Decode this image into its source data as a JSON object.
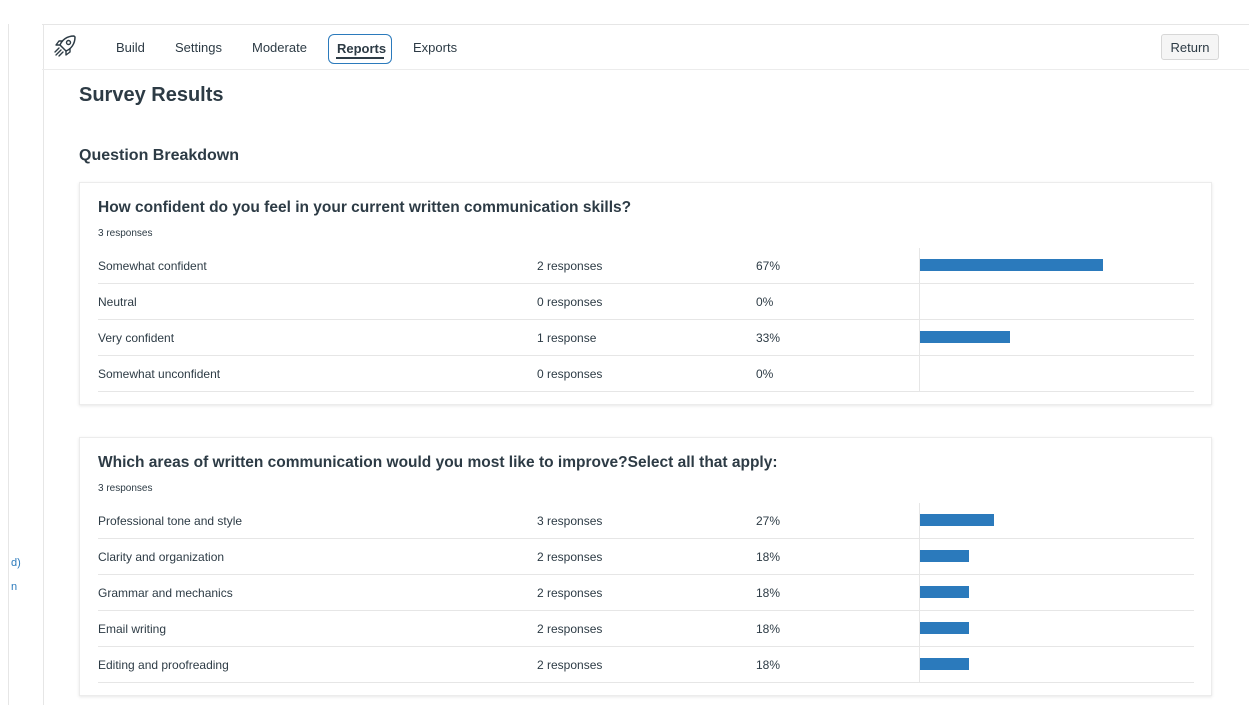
{
  "left_strip": {
    "fragments": [
      "d)",
      "n"
    ]
  },
  "nav": {
    "logo_icon": "rocket-icon",
    "tabs": [
      {
        "label": "Build",
        "active": false
      },
      {
        "label": "Settings",
        "active": false
      },
      {
        "label": "Moderate",
        "active": false
      },
      {
        "label": "Reports",
        "active": true
      },
      {
        "label": "Exports",
        "active": false
      }
    ],
    "return_label": "Return"
  },
  "page": {
    "title": "Survey Results",
    "section_title": "Question Breakdown"
  },
  "colors": {
    "accent": "#2b7abc",
    "text": "#2d3b45"
  },
  "questions": [
    {
      "title": "How confident do you feel in your current written communication skills?",
      "responses": "3 responses",
      "options": [
        {
          "label": "Somewhat confident",
          "count": "2 responses",
          "percent": "67%",
          "fraction": 0.67
        },
        {
          "label": "Neutral",
          "count": "0 responses",
          "percent": "0%",
          "fraction": 0
        },
        {
          "label": "Very confident",
          "count": "1 response",
          "percent": "33%",
          "fraction": 0.33
        },
        {
          "label": "Somewhat unconfident",
          "count": "0 responses",
          "percent": "0%",
          "fraction": 0
        }
      ]
    },
    {
      "title": "Which areas of written communication would you most like to improve?Select all that apply:",
      "responses": "3 responses",
      "options": [
        {
          "label": "Professional tone and style",
          "count": "3 responses",
          "percent": "27%",
          "fraction": 0.27
        },
        {
          "label": "Clarity and organization",
          "count": "2 responses",
          "percent": "18%",
          "fraction": 0.18
        },
        {
          "label": "Grammar and mechanics",
          "count": "2 responses",
          "percent": "18%",
          "fraction": 0.18
        },
        {
          "label": "Email writing",
          "count": "2 responses",
          "percent": "18%",
          "fraction": 0.18
        },
        {
          "label": "Editing and proofreading",
          "count": "2 responses",
          "percent": "18%",
          "fraction": 0.18
        }
      ]
    }
  ]
}
